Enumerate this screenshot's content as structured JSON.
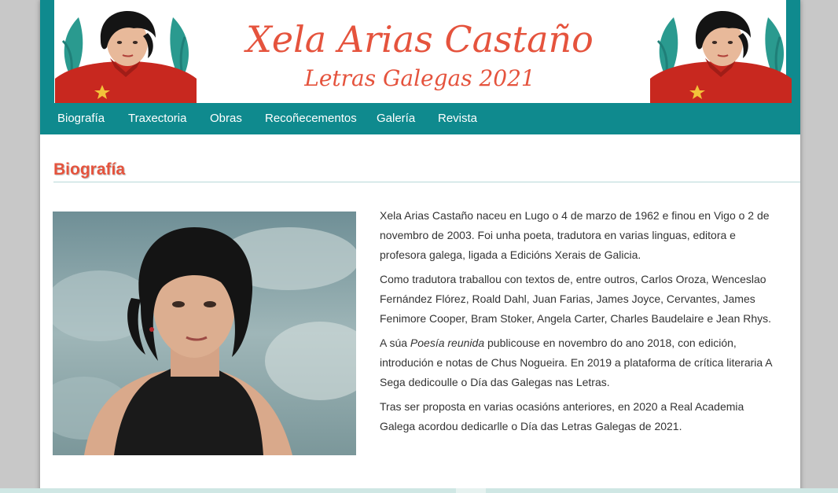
{
  "header": {
    "title": "Xela Arias Castaño",
    "subtitle": "Letras Galegas 2021"
  },
  "nav": {
    "items": [
      "Biografía",
      "Traxectoria",
      "Obras",
      "Recoñecementos",
      "Galería",
      "Revista"
    ]
  },
  "section": {
    "title": "Biografía"
  },
  "bio": {
    "p1": "Xela Arias Castaño naceu en Lugo o 4 de marzo de 1962 e finou en Vigo o 2 de novembro de 2003. Foi unha poeta, tradutora en varias linguas, editora e profesora galega, ligada a Edicións Xerais de Galicia.",
    "p2": "Como tradutora traballou con textos de, entre outros, Carlos Oroza, Wenceslao Fernández Flórez, Roald Dahl, Juan Farias, James Joyce, Cervantes, James Fenimore Cooper, Bram Stoker, Angela Carter, Charles Baudelaire e Jean Rhys.",
    "p3_before": "A súa ",
    "p3_em": "Poesía reunida",
    "p3_after": " publicouse en novembro do ano 2018, con edición, introdución e notas de Chus Nogueira. En 2019 a plataforma de crítica literaria A Sega dedicoulle o Día das Galegas nas Letras.",
    "p4": "Tras ser proposta en varias ocasións anteriores, en 2020 a Real Academia Galega acordou dedicarlle o Día das Letras Galegas de 2021."
  },
  "colors": {
    "accent": "#e5533d",
    "teal": "#0f8a8e",
    "background": "#c8c8c8"
  }
}
